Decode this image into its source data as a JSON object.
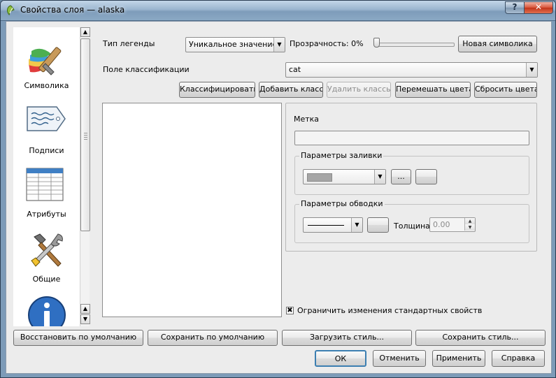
{
  "window": {
    "title": "Свойства слоя — alaska",
    "help_label": "?",
    "close_label": "✕"
  },
  "sidebar": {
    "items": [
      {
        "label": "Символика",
        "icon": "brush-icon"
      },
      {
        "label": "Подписи",
        "icon": "label-tag-icon"
      },
      {
        "label": "Атрибуты",
        "icon": "attribute-table-icon"
      },
      {
        "label": "Общие",
        "icon": "tools-icon"
      },
      {
        "label": "",
        "icon": "info-icon"
      }
    ]
  },
  "symbology": {
    "legend_type_label": "Тип легенды",
    "legend_type_value": "Уникальное значение",
    "transparency_label": "Прозрачность: 0%",
    "transparency_percent": 0,
    "new_symbology_label": "Новая символика",
    "classification_field_label": "Поле классификации",
    "classification_field_value": "cat",
    "buttons": {
      "classify": "Классифицировать",
      "add_class": "Добавить класс",
      "delete_classes": "Удалить классы",
      "shuffle_colors": "Перемешать цвета",
      "reset_colors": "Сбросить цвета"
    },
    "label_title": "Метка",
    "label_value": "",
    "fill_group_title": "Параметры заливки",
    "fill_color": "#a6a6a6",
    "fill_more_label": "...",
    "outline_group_title": "Параметры обводки",
    "width_label": "Толщина",
    "width_value": "0.00",
    "restrict_label": "Ограничить изменения стандартных свойств",
    "restrict_checked": "✖"
  },
  "footer": {
    "restore_default": "Восстановить по умолчанию",
    "save_default": "Сохранить по умолчанию",
    "load_style": "Загрузить стиль...",
    "save_style": "Сохранить стиль...",
    "ok": "ОК",
    "cancel": "Отменить",
    "apply": "Применить",
    "help": "Справка"
  }
}
